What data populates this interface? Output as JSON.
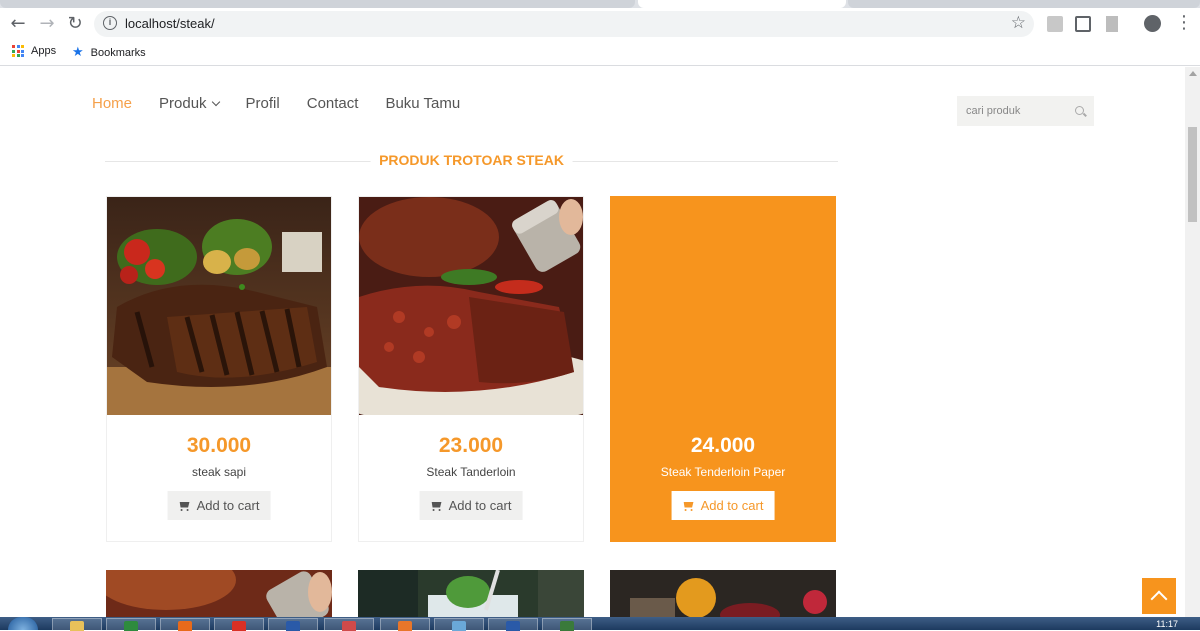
{
  "browser": {
    "url": "localhost/steak/",
    "bookmarks": [
      {
        "label": "Apps"
      },
      {
        "label": "Bookmarks"
      }
    ]
  },
  "nav": {
    "items": [
      {
        "label": "Home",
        "active": true
      },
      {
        "label": "Produk",
        "dropdown": true
      },
      {
        "label": "Profil"
      },
      {
        "label": "Contact"
      },
      {
        "label": "Buku Tamu"
      }
    ],
    "search_placeholder": "cari produk"
  },
  "section": {
    "title": "PRODUK TROTOAR STEAK"
  },
  "products": [
    {
      "price": "30.000",
      "name": "steak sapi",
      "cart_label": "Add to cart"
    },
    {
      "price": "23.000",
      "name": "Steak Tanderloin",
      "cart_label": "Add to cart"
    },
    {
      "price": "24.000",
      "name": "Steak Tenderloin Paper",
      "cart_label": "Add to cart",
      "highlighted": true
    }
  ],
  "taskbar": {
    "clock": "11:17"
  },
  "colors": {
    "accent": "#f7941d",
    "accent_text": "#f5982a",
    "nav_active": "#f5a04a"
  }
}
